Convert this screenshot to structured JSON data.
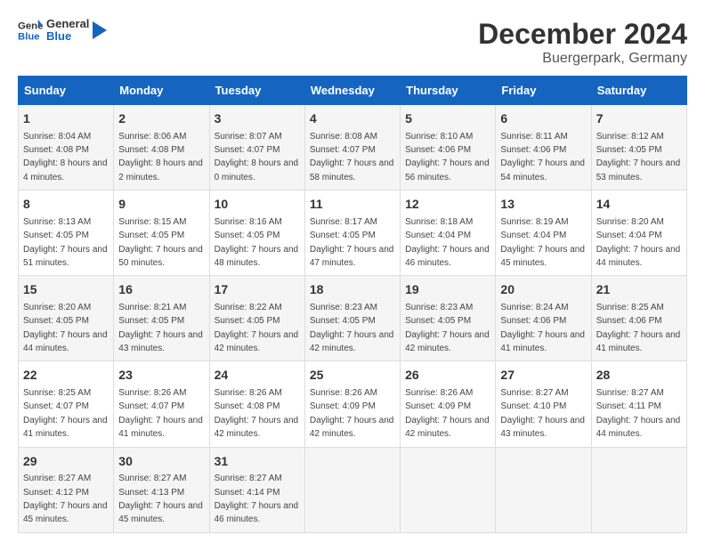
{
  "header": {
    "logo_general": "General",
    "logo_blue": "Blue",
    "title": "December 2024",
    "subtitle": "Buergerpark, Germany"
  },
  "calendar": {
    "days_of_week": [
      "Sunday",
      "Monday",
      "Tuesday",
      "Wednesday",
      "Thursday",
      "Friday",
      "Saturday"
    ],
    "weeks": [
      [
        {
          "day": "1",
          "sunrise": "8:04 AM",
          "sunset": "4:08 PM",
          "daylight": "8 hours and 4 minutes."
        },
        {
          "day": "2",
          "sunrise": "8:06 AM",
          "sunset": "4:08 PM",
          "daylight": "8 hours and 2 minutes."
        },
        {
          "day": "3",
          "sunrise": "8:07 AM",
          "sunset": "4:07 PM",
          "daylight": "8 hours and 0 minutes."
        },
        {
          "day": "4",
          "sunrise": "8:08 AM",
          "sunset": "4:07 PM",
          "daylight": "7 hours and 58 minutes."
        },
        {
          "day": "5",
          "sunrise": "8:10 AM",
          "sunset": "4:06 PM",
          "daylight": "7 hours and 56 minutes."
        },
        {
          "day": "6",
          "sunrise": "8:11 AM",
          "sunset": "4:06 PM",
          "daylight": "7 hours and 54 minutes."
        },
        {
          "day": "7",
          "sunrise": "8:12 AM",
          "sunset": "4:05 PM",
          "daylight": "7 hours and 53 minutes."
        }
      ],
      [
        {
          "day": "8",
          "sunrise": "8:13 AM",
          "sunset": "4:05 PM",
          "daylight": "7 hours and 51 minutes."
        },
        {
          "day": "9",
          "sunrise": "8:15 AM",
          "sunset": "4:05 PM",
          "daylight": "7 hours and 50 minutes."
        },
        {
          "day": "10",
          "sunrise": "8:16 AM",
          "sunset": "4:05 PM",
          "daylight": "7 hours and 48 minutes."
        },
        {
          "day": "11",
          "sunrise": "8:17 AM",
          "sunset": "4:05 PM",
          "daylight": "7 hours and 47 minutes."
        },
        {
          "day": "12",
          "sunrise": "8:18 AM",
          "sunset": "4:04 PM",
          "daylight": "7 hours and 46 minutes."
        },
        {
          "day": "13",
          "sunrise": "8:19 AM",
          "sunset": "4:04 PM",
          "daylight": "7 hours and 45 minutes."
        },
        {
          "day": "14",
          "sunrise": "8:20 AM",
          "sunset": "4:04 PM",
          "daylight": "7 hours and 44 minutes."
        }
      ],
      [
        {
          "day": "15",
          "sunrise": "8:20 AM",
          "sunset": "4:05 PM",
          "daylight": "7 hours and 44 minutes."
        },
        {
          "day": "16",
          "sunrise": "8:21 AM",
          "sunset": "4:05 PM",
          "daylight": "7 hours and 43 minutes."
        },
        {
          "day": "17",
          "sunrise": "8:22 AM",
          "sunset": "4:05 PM",
          "daylight": "7 hours and 42 minutes."
        },
        {
          "day": "18",
          "sunrise": "8:23 AM",
          "sunset": "4:05 PM",
          "daylight": "7 hours and 42 minutes."
        },
        {
          "day": "19",
          "sunrise": "8:23 AM",
          "sunset": "4:05 PM",
          "daylight": "7 hours and 42 minutes."
        },
        {
          "day": "20",
          "sunrise": "8:24 AM",
          "sunset": "4:06 PM",
          "daylight": "7 hours and 41 minutes."
        },
        {
          "day": "21",
          "sunrise": "8:25 AM",
          "sunset": "4:06 PM",
          "daylight": "7 hours and 41 minutes."
        }
      ],
      [
        {
          "day": "22",
          "sunrise": "8:25 AM",
          "sunset": "4:07 PM",
          "daylight": "7 hours and 41 minutes."
        },
        {
          "day": "23",
          "sunrise": "8:26 AM",
          "sunset": "4:07 PM",
          "daylight": "7 hours and 41 minutes."
        },
        {
          "day": "24",
          "sunrise": "8:26 AM",
          "sunset": "4:08 PM",
          "daylight": "7 hours and 42 minutes."
        },
        {
          "day": "25",
          "sunrise": "8:26 AM",
          "sunset": "4:09 PM",
          "daylight": "7 hours and 42 minutes."
        },
        {
          "day": "26",
          "sunrise": "8:26 AM",
          "sunset": "4:09 PM",
          "daylight": "7 hours and 42 minutes."
        },
        {
          "day": "27",
          "sunrise": "8:27 AM",
          "sunset": "4:10 PM",
          "daylight": "7 hours and 43 minutes."
        },
        {
          "day": "28",
          "sunrise": "8:27 AM",
          "sunset": "4:11 PM",
          "daylight": "7 hours and 44 minutes."
        }
      ],
      [
        {
          "day": "29",
          "sunrise": "8:27 AM",
          "sunset": "4:12 PM",
          "daylight": "7 hours and 45 minutes."
        },
        {
          "day": "30",
          "sunrise": "8:27 AM",
          "sunset": "4:13 PM",
          "daylight": "7 hours and 45 minutes."
        },
        {
          "day": "31",
          "sunrise": "8:27 AM",
          "sunset": "4:14 PM",
          "daylight": "7 hours and 46 minutes."
        },
        null,
        null,
        null,
        null
      ]
    ]
  },
  "labels": {
    "sunrise_prefix": "Sunrise: ",
    "sunset_prefix": "Sunset: ",
    "daylight_prefix": "Daylight: "
  }
}
